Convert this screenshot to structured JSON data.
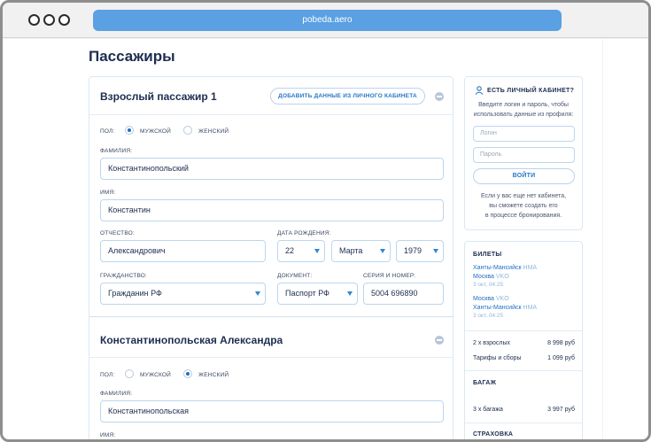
{
  "browser": {
    "url": "pobeda.aero"
  },
  "page": {
    "title": "Пассажиры"
  },
  "passenger1": {
    "title": "Взрослый пассажир 1",
    "add_from_account": "ДОБАВИТЬ ДАННЫЕ ИЗ ЛИЧНОГО КАБИНЕТА",
    "gender_label": "ПОЛ:",
    "male": "МУЖСКОЙ",
    "female": "ЖЕНСКИЙ",
    "gender_selected": "male",
    "surname_label": "ФАМИЛИЯ:",
    "surname": "Константинопольский",
    "name_label": "ИМЯ:",
    "name": "Константин",
    "patronymic_label": "ОТЧЕСТВО:",
    "patronymic": "Александрович",
    "birthdate_label": "ДАТА РОЖДЕНИЯ:",
    "birth_day": "22",
    "birth_month": "Марта",
    "birth_year": "1979",
    "citizenship_label": "ГРАЖДАНСТВО:",
    "citizenship": "Гражданин РФ",
    "document_label": "ДОКУМЕНТ:",
    "document": "Паспорт РФ",
    "series_label": "СЕРИЯ И НОМЕР:",
    "series": "5004 696890"
  },
  "passenger2": {
    "title": "Константинопольская Александра",
    "gender_label": "ПОЛ:",
    "male": "МУЖСКОЙ",
    "female": "ЖЕНСКИЙ",
    "gender_selected": "female",
    "surname_label": "ФАМИЛИЯ:",
    "surname": "Константинопольская",
    "name_label": "ИМЯ:"
  },
  "login": {
    "title": "ЕСТЬ ЛИЧНЫЙ КАБИНЕТ?",
    "hint_line1": "Введите логин и пароль, чтобы",
    "hint_line2": "использовать данные из профиля:",
    "login_placeholder": "Логин",
    "password_placeholder": "Пароль",
    "submit": "ВОЙТИ",
    "note_line1": "Если у вас еще нет кабинета,",
    "note_line2": "вы сможете создать его",
    "note_line3": "в процессе бронирования."
  },
  "summary": {
    "tickets_title": "БИЛЕТЫ",
    "flights": [
      {
        "from": "Ханты-Мансийск",
        "from_code": "HMA",
        "to": "Москва",
        "to_code": "VKO",
        "date": "3 окт, 04:25"
      },
      {
        "from": "Москва",
        "from_code": "VKO",
        "to": "Ханты-Мансийск",
        "to_code": "HMA",
        "date": "3 окт, 04:25"
      }
    ],
    "adults_label": "2 х взрослых",
    "adults_price": "8 998 руб",
    "fees_label": "Тарифы и сборы",
    "fees_price": "1 099 руб",
    "baggage_title": "БАГАЖ",
    "baggage_label": "3 х багажа",
    "baggage_price": "3 997 руб",
    "insurance_title": "СТРАХОВКА"
  },
  "colors": {
    "accent": "#2576c6",
    "title": "#1d2d50",
    "border": "#bcd6ee",
    "url_bar": "#5aa0e2"
  }
}
